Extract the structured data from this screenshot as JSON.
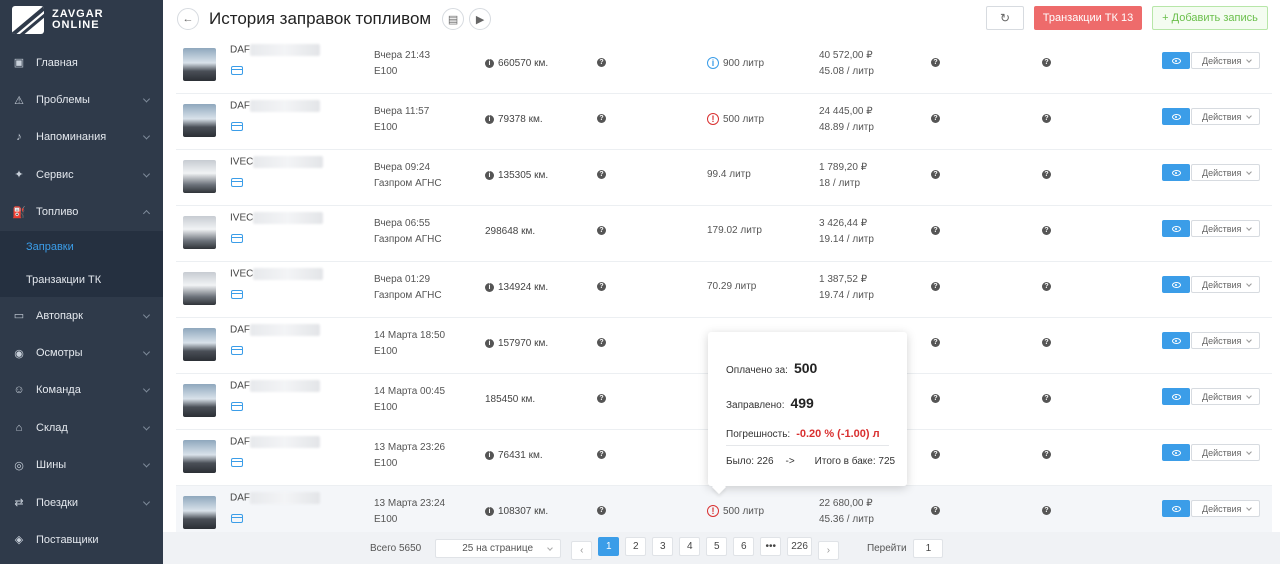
{
  "brand": {
    "line1": "ZAVGAR",
    "line2": "ONLINE"
  },
  "sidebar": {
    "items": [
      {
        "label": "Главная",
        "icon": "dashboard-icon",
        "symbol": "▣"
      },
      {
        "label": "Проблемы",
        "icon": "warning-icon",
        "symbol": "⚠"
      },
      {
        "label": "Напоминания",
        "icon": "bell-icon",
        "symbol": "♪"
      },
      {
        "label": "Сервис",
        "icon": "wrench-icon",
        "symbol": "✦"
      },
      {
        "label": "Топливо",
        "icon": "fuel-icon",
        "symbol": "⛽"
      },
      {
        "label": "Автопарк",
        "icon": "truck-icon",
        "symbol": "▭"
      },
      {
        "label": "Осмотры",
        "icon": "eye-icon",
        "symbol": "◉"
      },
      {
        "label": "Команда",
        "icon": "team-icon",
        "symbol": "☺"
      },
      {
        "label": "Склад",
        "icon": "warehouse-icon",
        "symbol": "⌂"
      },
      {
        "label": "Шины",
        "icon": "tire-icon",
        "symbol": "◎"
      },
      {
        "label": "Поездки",
        "icon": "trips-icon",
        "symbol": "⇄"
      },
      {
        "label": "Поставщики",
        "icon": "box-icon",
        "symbol": "◈"
      }
    ],
    "subitems": [
      {
        "label": "Заправки",
        "active": true
      },
      {
        "label": "Транзакции ТК",
        "active": false
      }
    ]
  },
  "header": {
    "title": "История заправок топливом",
    "tk_button": "Транзакции ТК 13",
    "add_button": "+ Добавить запись"
  },
  "rows": [
    {
      "vehicle": "DAF",
      "when": "Вчера 21:43",
      "station": "E100",
      "odometer": "660570 км.",
      "odo_icon": true,
      "liters": "900 литр",
      "liter_icon": "info",
      "total": "40 572,00 ₽",
      "per_liter": "45.08 / литр",
      "van": false
    },
    {
      "vehicle": "DAF",
      "when": "Вчера 11:57",
      "station": "E100",
      "odometer": "79378 км.",
      "odo_icon": true,
      "liters": "500 литр",
      "liter_icon": "err",
      "total": "24 445,00 ₽",
      "per_liter": "48.89 / литр",
      "van": false
    },
    {
      "vehicle": "IVEC",
      "when": "Вчера 09:24",
      "station": "Газпром АГНС",
      "odometer": "135305 км.",
      "odo_icon": true,
      "liters": "99.4 литр",
      "liter_icon": "",
      "total": "1 789,20 ₽",
      "per_liter": "18 / литр",
      "van": true
    },
    {
      "vehicle": "IVEC",
      "when": "Вчера 06:55",
      "station": "Газпром АГНС",
      "odometer": "298648 км.",
      "odo_icon": false,
      "liters": "179.02 литр",
      "liter_icon": "",
      "total": "3 426,44 ₽",
      "per_liter": "19.14 / литр",
      "van": true
    },
    {
      "vehicle": "IVEC",
      "when": "Вчера 01:29",
      "station": "Газпром АГНС",
      "odometer": "134924 км.",
      "odo_icon": true,
      "liters": "70.29 литр",
      "liter_icon": "",
      "total": "1 387,52 ₽",
      "per_liter": "19.74 / литр",
      "van": true
    },
    {
      "vehicle": "DAF",
      "when": "14 Марта 18:50",
      "station": "E100",
      "odometer": "157970 км.",
      "odo_icon": true,
      "liters": "",
      "liter_icon": "",
      "total": "",
      "per_liter": "",
      "van": false
    },
    {
      "vehicle": "DAF",
      "when": "14 Марта 00:45",
      "station": "E100",
      "odometer": "185450 км.",
      "odo_icon": false,
      "liters": "",
      "liter_icon": "",
      "total": "",
      "per_liter": "",
      "van": false
    },
    {
      "vehicle": "DAF",
      "when": "13 Марта 23:26",
      "station": "E100",
      "odometer": "76431 км.",
      "odo_icon": true,
      "liters": "",
      "liter_icon": "",
      "total": "",
      "per_liter": "",
      "van": false
    },
    {
      "vehicle": "DAF",
      "when": "13 Марта 23:24",
      "station": "E100",
      "odometer": "108307 км.",
      "odo_icon": true,
      "liters": "500 литр",
      "liter_icon": "err",
      "total": "22 680,00 ₽",
      "per_liter": "45.36 / литр",
      "van": false,
      "highlight": true
    }
  ],
  "actions_label": "Действия",
  "popup": {
    "paid_label": "Оплачено за:",
    "paid_value": "500",
    "filled_label": "Заправлено:",
    "filled_value": "499",
    "error_label": "Погрешность:",
    "error_value": "-0.20 % (-1.00) л",
    "was_label": "Было: 226",
    "arrow": "->",
    "tank_label": "Итого в баке: 725"
  },
  "pagination": {
    "total": "Всего 5650",
    "per_page": "25 на странице",
    "pages": [
      "1",
      "2",
      "3",
      "4",
      "5",
      "6",
      "•••",
      "226"
    ],
    "current": "1",
    "goto_label": "Перейти",
    "goto_value": "1"
  },
  "colors": {
    "accent": "#3b9de8",
    "danger": "#ee6b6b",
    "success": "#6abf4b",
    "sidebar": "#2f3a4a"
  }
}
